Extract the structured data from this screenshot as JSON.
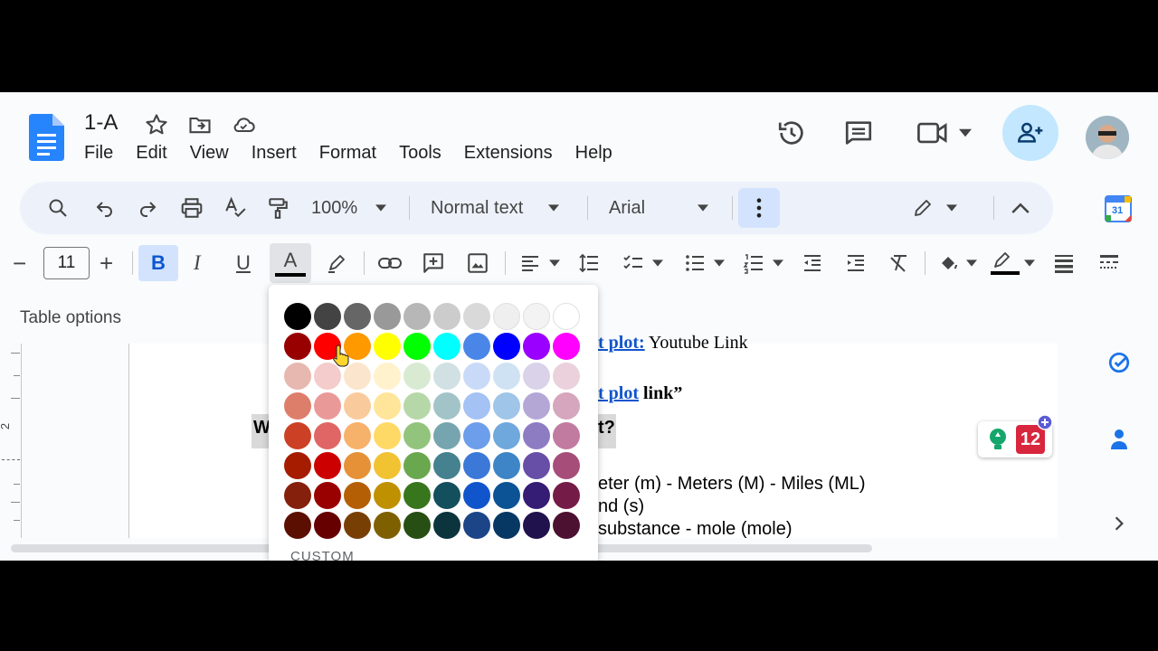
{
  "doc": {
    "title": "1-A"
  },
  "menu": [
    "File",
    "Edit",
    "View",
    "Insert",
    "Format",
    "Tools",
    "Extensions",
    "Help"
  ],
  "toolbar": {
    "zoom": "100%",
    "style": "Normal text",
    "font": "Arial",
    "font_size": "11",
    "minus": "−",
    "plus": "+",
    "bold": "B",
    "italic": "I",
    "underline": "U",
    "text_color": "A"
  },
  "table_options": "Table options",
  "calendar_badge": "31",
  "palette": {
    "custom_label": "CUSTOM",
    "rows": [
      [
        "#000000",
        "#434343",
        "#666666",
        "#999999",
        "#b7b7b7",
        "#cccccc",
        "#d9d9d9",
        "#efefef",
        "#f3f3f3",
        "#ffffff"
      ],
      [
        "#980000",
        "#ff0000",
        "#ff9900",
        "#ffff00",
        "#00ff00",
        "#00ffff",
        "#4a86e8",
        "#0000ff",
        "#9900ff",
        "#ff00ff"
      ],
      [
        "#e6b8af",
        "#f4cccc",
        "#fce5cd",
        "#fff2cc",
        "#d9ead3",
        "#d0e0e3",
        "#c9daf8",
        "#cfe2f3",
        "#d9d2e9",
        "#ead1dc"
      ],
      [
        "#dd7e6b",
        "#ea9999",
        "#f9cb9c",
        "#ffe599",
        "#b6d7a8",
        "#a2c4c9",
        "#a4c2f4",
        "#9fc5e8",
        "#b4a7d6",
        "#d5a6bd"
      ],
      [
        "#cc4125",
        "#e06666",
        "#f6b26b",
        "#ffd966",
        "#93c47d",
        "#76a5af",
        "#6d9eeb",
        "#6fa8dc",
        "#8e7cc3",
        "#c27ba0"
      ],
      [
        "#a61c00",
        "#cc0000",
        "#e69138",
        "#f1c232",
        "#6aa84f",
        "#45818e",
        "#3c78d8",
        "#3d85c6",
        "#674ea7",
        "#a64d79"
      ],
      [
        "#85200c",
        "#990000",
        "#b45f06",
        "#bf9000",
        "#38761d",
        "#134f5c",
        "#1155cc",
        "#0b5394",
        "#351c75",
        "#741b47"
      ],
      [
        "#5b0f00",
        "#660000",
        "#783f04",
        "#7f6000",
        "#274e13",
        "#0c343d",
        "#1c4587",
        "#073763",
        "#20124d",
        "#4c1130"
      ]
    ]
  },
  "doc_lines": {
    "line1_link": "t plot:",
    "line1_rest": " Youtube Link",
    "line2_link": "t plot",
    "line2_rest": " link”",
    "heading_left": "W",
    "heading_right": "t?",
    "l3": "eter (m) - Meters (M) - Miles (ML)",
    "l4": "nd (s)",
    "l5": "substance - mole (mole)"
  },
  "badge_count": "12",
  "ruler_mark": "2",
  "colors": {
    "accent": "#1a73e8",
    "share_bg": "#c2e7ff",
    "toolbar_bg": "#edf2fa"
  }
}
